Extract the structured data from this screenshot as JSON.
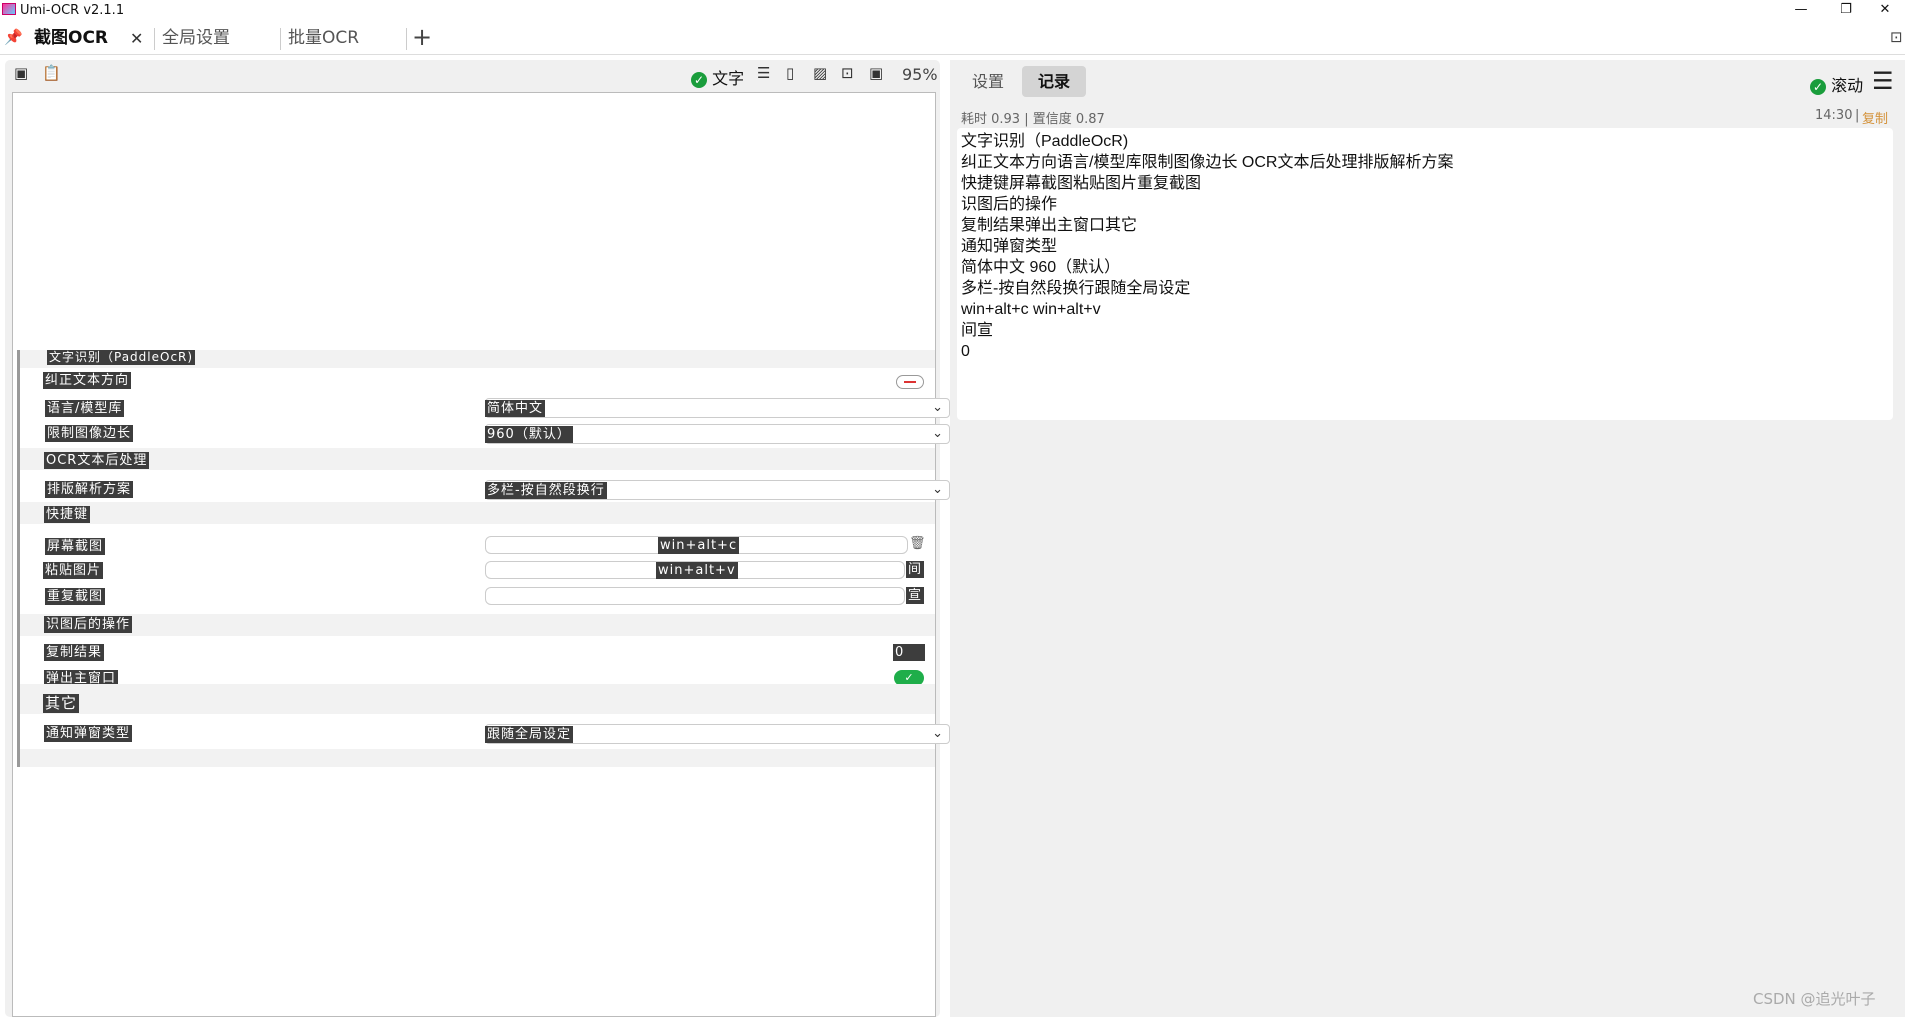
{
  "window": {
    "title": "Umi-OCR v2.1.1",
    "minimize": "—",
    "restore": "❐",
    "close": "✕"
  },
  "tabs": [
    {
      "label": "截图OCR",
      "close": "✕"
    },
    {
      "label": "全局设置"
    },
    {
      "label": "批量OCR"
    }
  ],
  "add_tab": "+",
  "left_toolbar": {
    "text_toggle": "文字",
    "zoom": "95%"
  },
  "ocr_image": {
    "header": "文字识别（PaddleOcR)",
    "rows": {
      "correct_direction": "纠正文本方向",
      "language": "语言/模型库",
      "language_value": "简体中文",
      "limit": "限制图像边长",
      "limit_value": "960（默认）",
      "postprocess": "OCR文本后处理",
      "layout": "排版解析方案",
      "layout_value": "多栏-按自然段换行",
      "hotkey": "快捷键",
      "screenshot": "屏幕截图",
      "screenshot_value": "win+alt+c",
      "paste": "粘贴图片",
      "paste_value": "win+alt+v",
      "paste_side": "间",
      "repeat": "重复截图",
      "repeat_side": "宣",
      "after": "识图后的操作",
      "copy": "复制结果",
      "copy_value": "0",
      "popup": "弹出主窗口",
      "other": "其它",
      "notify": "通知弹窗类型",
      "notify_value": "跟随全局设定"
    }
  },
  "right_tabs": {
    "settings": "设置",
    "records": "记录"
  },
  "scroll_toggle": "滚动",
  "record": {
    "meta": "耗时 0.93 | 置信度 0.87",
    "time": "14:30",
    "sep": "|",
    "copy": "复制",
    "lines": [
      "文字识别（PaddleOcR)",
      "纠正文本方向语言/模型库限制图像边长 OCR文本后处理排版解析方案",
      "快捷键屏幕截图粘贴图片重复截图",
      "识图后的操作",
      "复制结果弹出主窗口其它",
      "通知弹窗类型",
      "简体中文 960（默认）",
      "多栏-按自然段换行跟随全局设定",
      "win+alt+c win+alt+v",
      "间宣",
      "0"
    ]
  },
  "watermark": "CSDN @追光叶子"
}
